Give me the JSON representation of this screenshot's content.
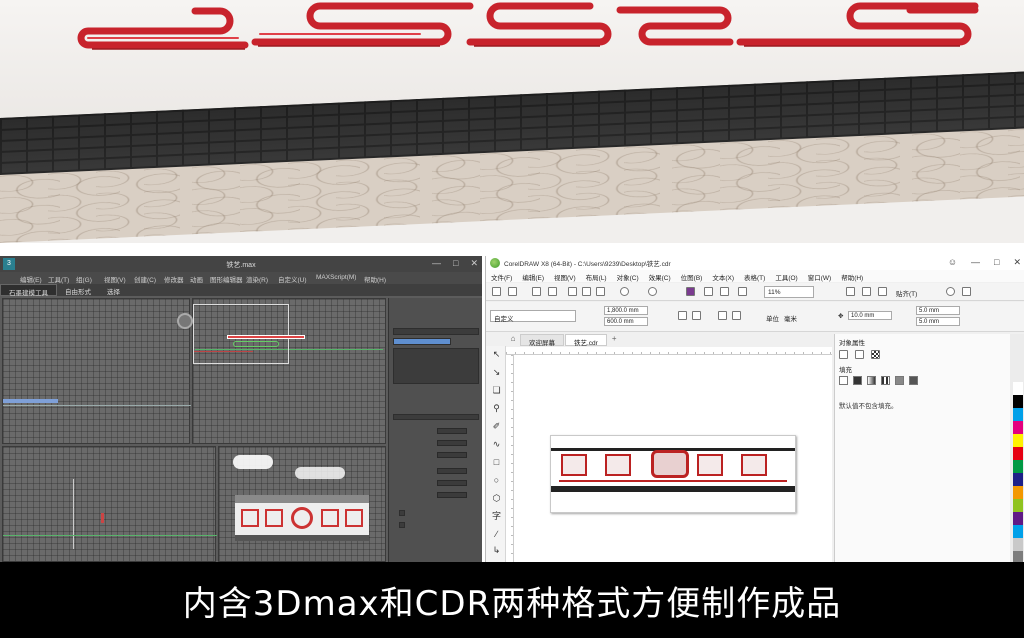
{
  "max_window": {
    "title": "铁艺.max",
    "logo": "3",
    "menus": [
      "编辑(E)",
      "工具(T)",
      "组(G)",
      "视图(V)",
      "创建(C)",
      "修改器",
      "动画",
      "图形编辑器",
      "渲染(R)",
      "自定义(U)",
      "MAXScript(M)",
      "帮助(H)"
    ],
    "ribbon_tabs": [
      "石墨建模工具",
      "自由形式",
      "选择"
    ]
  },
  "cdr_window": {
    "title": "CorelDRAW X8 (64-Bit) - C:\\Users\\9239\\Desktop\\铁艺.cdr",
    "menus": [
      "文件(F)",
      "编辑(E)",
      "视图(V)",
      "布局(L)",
      "对象(C)",
      "效果(C)",
      "位图(B)",
      "文本(X)",
      "表格(T)",
      "工具(O)",
      "窗口(W)",
      "帮助(H)"
    ],
    "zoom": "11%",
    "snap_to": "贴齐(T)",
    "page_preset": "自定义",
    "width_value": "1,800.0 mm",
    "height_value": "600.0 mm",
    "units_label": "单位",
    "units_value": "毫米",
    "nudge_value": "10.0 mm",
    "dup_x": "5.0 mm",
    "dup_y": "5.0 mm",
    "tabs": [
      "欢迎屏幕",
      "铁艺.cdr"
    ],
    "docker_title": "对象属性",
    "fill_label": "填充",
    "fill_note": "默认值不包含填充。",
    "palette_colors": [
      "#ffffff",
      "#000000",
      "#00a0e9",
      "#e4007f",
      "#fff100",
      "#e60012",
      "#009944",
      "#1d2088",
      "#f39800",
      "#8fc31f",
      "#601986",
      "#00a0e9",
      "#c9c9c9",
      "#7d7d7d"
    ]
  },
  "caption": {
    "text": "内含3Dmax和CDR两种格式方便制作成品"
  }
}
